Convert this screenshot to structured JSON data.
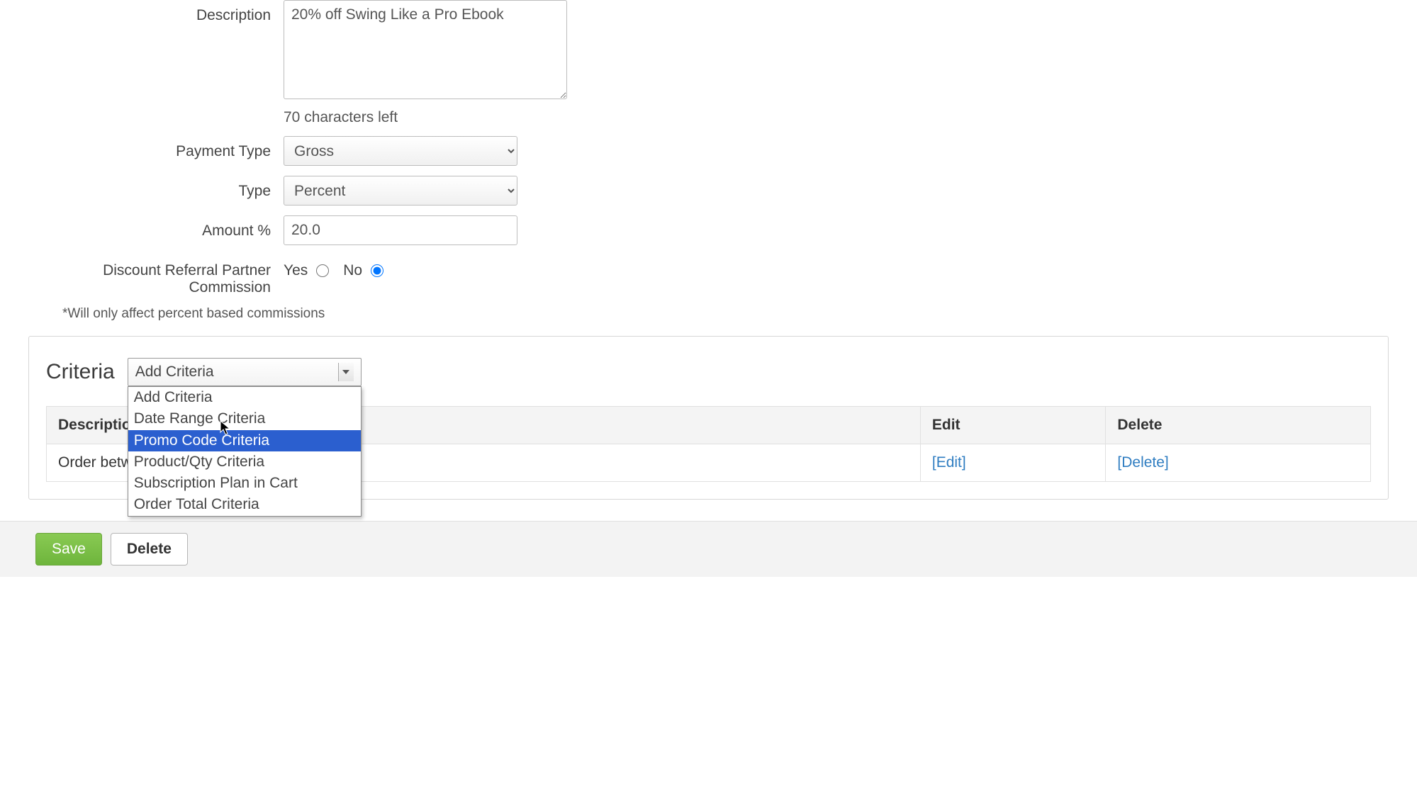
{
  "form": {
    "description_label": "Description",
    "description_value": "20% off Swing Like a Pro Ebook",
    "chars_left": "70 characters left",
    "payment_type_label": "Payment Type",
    "payment_type_value": "Gross",
    "type_label": "Type",
    "type_value": "Percent",
    "amount_label": "Amount %",
    "amount_value": "20.0",
    "discount_commission_label": "Discount Referral Partner Commission",
    "yes_label": "Yes",
    "no_label": "No",
    "hint": "*Will only affect percent based commissions"
  },
  "criteria": {
    "title": "Criteria",
    "select_value": "Add Criteria",
    "options": [
      {
        "label": "Add Criteria",
        "highlight": false
      },
      {
        "label": "Date Range Criteria",
        "highlight": false
      },
      {
        "label": "Promo Code Criteria",
        "highlight": true
      },
      {
        "label": "Product/Qty Criteria",
        "highlight": false
      },
      {
        "label": "Subscription Plan in Cart",
        "highlight": false
      },
      {
        "label": "Order Total Criteria",
        "highlight": false
      }
    ],
    "table": {
      "headers": {
        "description": "Description",
        "edit": "Edit",
        "delete": "Delete"
      },
      "rows": [
        {
          "description": "Order betwe",
          "edit": "[Edit]",
          "delete": "[Delete]"
        }
      ]
    }
  },
  "footer": {
    "save": "Save",
    "delete": "Delete"
  }
}
